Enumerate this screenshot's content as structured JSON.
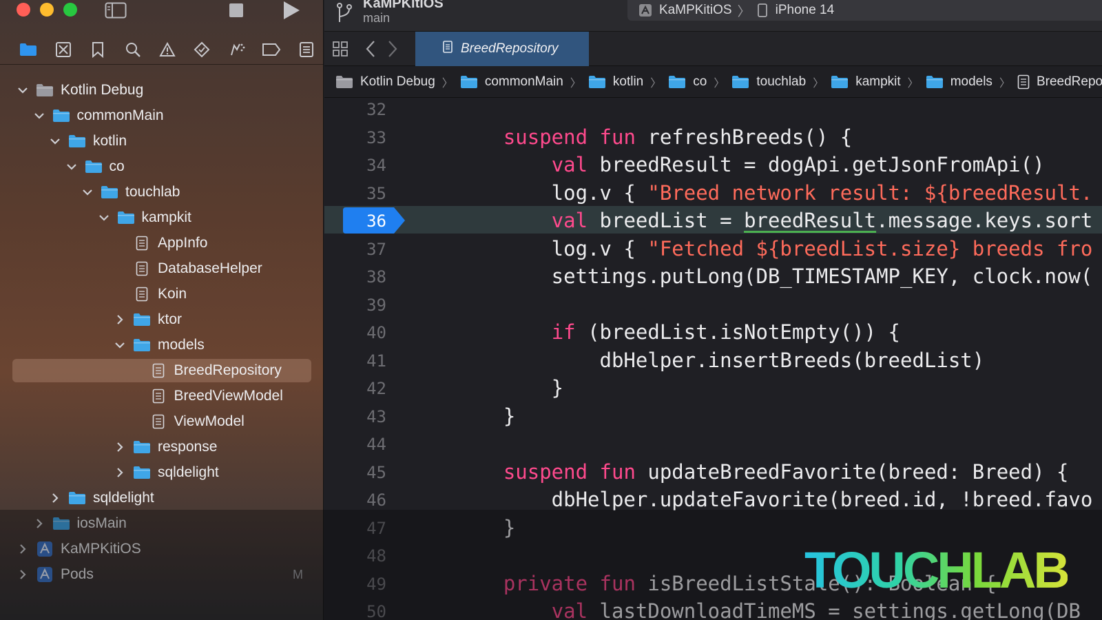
{
  "window": {
    "project_name": "KaMPKitiOS",
    "branch": "main",
    "scheme": "KaMPKitiOS",
    "destination": "iPhone 14"
  },
  "navigator": {
    "tree": [
      {
        "label": "Kotlin Debug",
        "depth": 0,
        "expanded": true,
        "kind": "group-gray"
      },
      {
        "label": "commonMain",
        "depth": 1,
        "expanded": true,
        "kind": "folder"
      },
      {
        "label": "kotlin",
        "depth": 2,
        "expanded": true,
        "kind": "folder"
      },
      {
        "label": "co",
        "depth": 3,
        "expanded": true,
        "kind": "folder"
      },
      {
        "label": "touchlab",
        "depth": 4,
        "expanded": true,
        "kind": "folder"
      },
      {
        "label": "kampkit",
        "depth": 5,
        "expanded": true,
        "kind": "folder"
      },
      {
        "label": "AppInfo",
        "depth": 6,
        "kind": "file"
      },
      {
        "label": "DatabaseHelper",
        "depth": 6,
        "kind": "file"
      },
      {
        "label": "Koin",
        "depth": 6,
        "kind": "file"
      },
      {
        "label": "ktor",
        "depth": 6,
        "expanded": false,
        "kind": "folder"
      },
      {
        "label": "models",
        "depth": 6,
        "expanded": true,
        "kind": "folder"
      },
      {
        "label": "BreedRepository",
        "depth": 7,
        "kind": "file",
        "selected": true
      },
      {
        "label": "BreedViewModel",
        "depth": 7,
        "kind": "file"
      },
      {
        "label": "ViewModel",
        "depth": 7,
        "kind": "file"
      },
      {
        "label": "response",
        "depth": 6,
        "expanded": false,
        "kind": "folder"
      },
      {
        "label": "sqldelight",
        "depth": 6,
        "expanded": false,
        "kind": "folder"
      },
      {
        "label": "sqldelight",
        "depth": 2,
        "expanded": false,
        "kind": "folder"
      },
      {
        "label": "iosMain",
        "depth": 1,
        "expanded": false,
        "kind": "folder"
      },
      {
        "label": "KaMPKitiOS",
        "depth": 0,
        "expanded": false,
        "kind": "project"
      },
      {
        "label": "Pods",
        "depth": 0,
        "expanded": false,
        "kind": "project",
        "badge": "M"
      }
    ]
  },
  "editor": {
    "active_tab": "BreedRepository",
    "breadcrumbs": [
      "Kotlin Debug",
      "commonMain",
      "kotlin",
      "co",
      "touchlab",
      "kampkit",
      "models",
      "BreedReposit"
    ],
    "current_line": 36,
    "lines": [
      {
        "num": "32",
        "tokens": []
      },
      {
        "num": "33",
        "tokens": [
          {
            "t": "    "
          },
          {
            "t": "suspend",
            "c": "kw"
          },
          {
            "t": " "
          },
          {
            "t": "fun",
            "c": "kw"
          },
          {
            "t": " refreshBreeds() {"
          }
        ]
      },
      {
        "num": "34",
        "tokens": [
          {
            "t": "        "
          },
          {
            "t": "val",
            "c": "kw"
          },
          {
            "t": " breedResult = dogApi.getJsonFromApi()"
          }
        ]
      },
      {
        "num": "35",
        "tokens": [
          {
            "t": "        log.v { "
          },
          {
            "t": "\"Breed network result: ${breedResult.",
            "c": "str"
          }
        ]
      },
      {
        "num": "36",
        "tokens": [
          {
            "t": "        "
          },
          {
            "t": "val",
            "c": "kw"
          },
          {
            "t": " breedList = "
          },
          {
            "t": "breedResult",
            "c": "ul"
          },
          {
            "t": ".message.keys.sort"
          }
        ]
      },
      {
        "num": "37",
        "tokens": [
          {
            "t": "        log.v { "
          },
          {
            "t": "\"Fetched ${breedList.size} breeds fro",
            "c": "str"
          }
        ]
      },
      {
        "num": "38",
        "tokens": [
          {
            "t": "        settings.putLong(DB_TIMESTAMP_KEY, clock.now("
          }
        ]
      },
      {
        "num": "39",
        "tokens": []
      },
      {
        "num": "40",
        "tokens": [
          {
            "t": "        "
          },
          {
            "t": "if",
            "c": "kw"
          },
          {
            "t": " (breedList.isNotEmpty()) {"
          }
        ]
      },
      {
        "num": "41",
        "tokens": [
          {
            "t": "            dbHelper.insertBreeds(breedList)"
          }
        ]
      },
      {
        "num": "42",
        "tokens": [
          {
            "t": "        }"
          }
        ]
      },
      {
        "num": "43",
        "tokens": [
          {
            "t": "    }"
          }
        ]
      },
      {
        "num": "44",
        "tokens": []
      },
      {
        "num": "45",
        "tokens": [
          {
            "t": "    "
          },
          {
            "t": "suspend",
            "c": "kw"
          },
          {
            "t": " "
          },
          {
            "t": "fun",
            "c": "kw"
          },
          {
            "t": " updateBreedFavorite(breed: Breed) {"
          }
        ]
      },
      {
        "num": "46",
        "tokens": [
          {
            "t": "        dbHelper.updateFavorite(breed.id, !breed.favo"
          }
        ]
      },
      {
        "num": "47",
        "tokens": [
          {
            "t": "    }"
          }
        ]
      },
      {
        "num": "48",
        "tokens": []
      },
      {
        "num": "49",
        "tokens": [
          {
            "t": "    "
          },
          {
            "t": "private",
            "c": "kw"
          },
          {
            "t": " "
          },
          {
            "t": "fun",
            "c": "kw"
          },
          {
            "t": " isBreedListStale(): Boolean {"
          }
        ]
      },
      {
        "num": "50",
        "tokens": [
          {
            "t": "        "
          },
          {
            "t": "val",
            "c": "kw"
          },
          {
            "t": " lastDownloadTimeMS = settings.getLong(DB"
          }
        ]
      }
    ]
  },
  "watermark": "TOUCHLAB",
  "colors": {
    "keyword": "#ff4a8d",
    "string": "#ff6b5b",
    "active_tab": "#31557e",
    "folder": "#3fa6e8",
    "breakpoint": "#1f7ff0"
  },
  "icons": {
    "navigator_bar": [
      "folder-icon",
      "source-control-icon",
      "bookmark-icon",
      "search-icon",
      "warning-icon",
      "test-icon",
      "debug-icon",
      "breakpoint-icon",
      "report-icon"
    ]
  }
}
